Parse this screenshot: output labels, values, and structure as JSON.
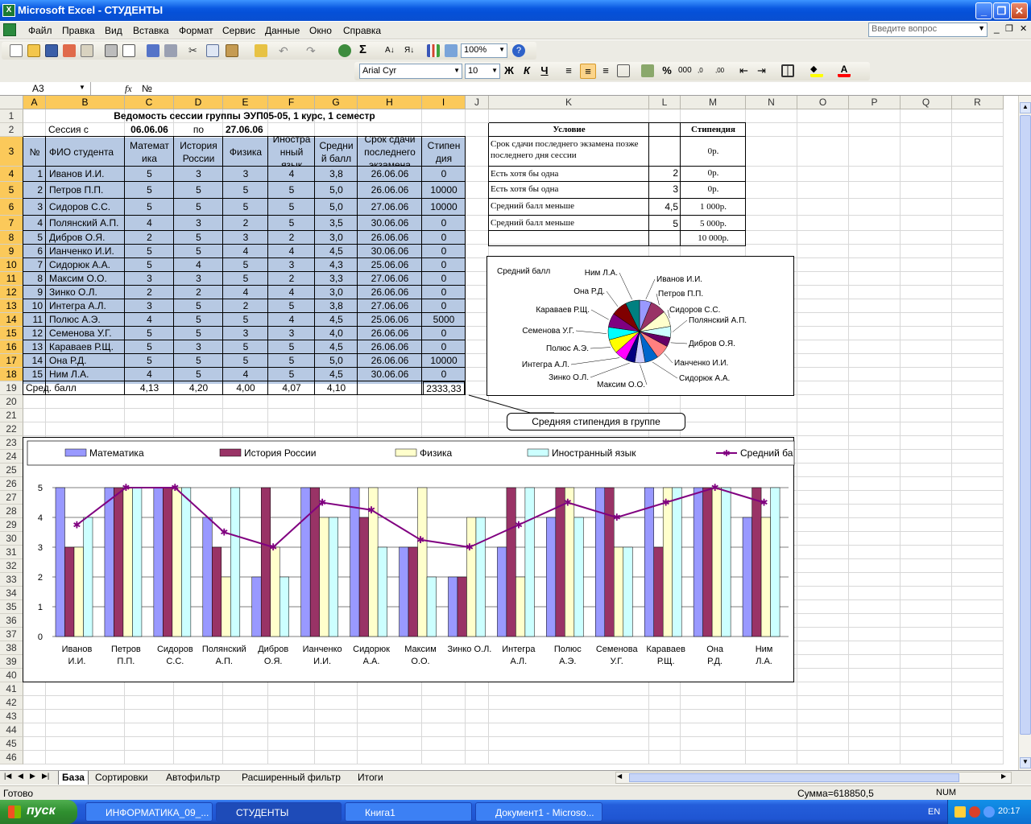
{
  "window": {
    "title": "Microsoft Excel - СТУДЕНТЫ"
  },
  "menu": [
    "Файл",
    "Правка",
    "Вид",
    "Вставка",
    "Формат",
    "Сервис",
    "Данные",
    "Окно",
    "Справка"
  ],
  "menu_extra": {
    "question_placeholder": "Введите вопрос"
  },
  "toolbar": {
    "zoom": "100%",
    "font": "Arial Cyr",
    "font_size": "10"
  },
  "formula_bar": {
    "name_box": "A3",
    "content": "№"
  },
  "columns": [
    "A",
    "B",
    "C",
    "D",
    "E",
    "F",
    "G",
    "H",
    "I",
    "J",
    "K",
    "L",
    "M",
    "N",
    "O",
    "P",
    "Q",
    "R"
  ],
  "selected_columns": [
    "A",
    "B",
    "C",
    "D",
    "E",
    "F",
    "G",
    "H",
    "I"
  ],
  "rows": [
    "1",
    "2",
    "3",
    "4",
    "5",
    "6",
    "7",
    "8",
    "9",
    "10",
    "11",
    "12",
    "13",
    "14",
    "15",
    "16",
    "17",
    "18",
    "19",
    "20",
    "21",
    "22",
    "23",
    "24",
    "25",
    "26",
    "27",
    "28",
    "29",
    "30",
    "31",
    "32",
    "33",
    "34",
    "35",
    "36",
    "37",
    "38",
    "39",
    "40",
    "41",
    "42",
    "43",
    "44",
    "45",
    "46"
  ],
  "sheet": {
    "title": "Ведомость сессии группы ЭУП05-05, 1 курс, 1 семестр",
    "session_from_label": "Сессия с",
    "session_from": "06.06.06",
    "session_to_label": "по",
    "session_to": "27.06.06",
    "headers": [
      "№",
      "ФИО студента",
      "Математ ика",
      "История России",
      "Физика",
      "Иностра нный язык",
      "Средни й балл",
      "Срок сдачи последнего экзамена",
      "Стипен дия"
    ],
    "students": [
      [
        "1",
        "Иванов И.И.",
        "5",
        "3",
        "3",
        "4",
        "3,8",
        "26.06.06",
        "0"
      ],
      [
        "2",
        "Петров П.П.",
        "5",
        "5",
        "5",
        "5",
        "5,0",
        "26.06.06",
        "10000"
      ],
      [
        "3",
        "Сидоров С.С.",
        "5",
        "5",
        "5",
        "5",
        "5,0",
        "27.06.06",
        "10000"
      ],
      [
        "4",
        "Полянский А.П.",
        "4",
        "3",
        "2",
        "5",
        "3,5",
        "30.06.06",
        "0"
      ],
      [
        "5",
        "Дибров О.Я.",
        "2",
        "5",
        "3",
        "2",
        "3,0",
        "26.06.06",
        "0"
      ],
      [
        "6",
        "Ианченко И.И.",
        "5",
        "5",
        "4",
        "4",
        "4,5",
        "30.06.06",
        "0"
      ],
      [
        "7",
        "Сидорюк А.А.",
        "5",
        "4",
        "5",
        "3",
        "4,3",
        "25.06.06",
        "0"
      ],
      [
        "8",
        "Максим О.О.",
        "3",
        "3",
        "5",
        "2",
        "3,3",
        "27.06.06",
        "0"
      ],
      [
        "9",
        "Зинко О.Л.",
        "2",
        "2",
        "4",
        "4",
        "3,0",
        "26.06.06",
        "0"
      ],
      [
        "10",
        "Интегра А.Л.",
        "3",
        "5",
        "2",
        "5",
        "3,8",
        "27.06.06",
        "0"
      ],
      [
        "11",
        "Полюс А.Э.",
        "4",
        "5",
        "5",
        "4",
        "4,5",
        "25.06.06",
        "5000"
      ],
      [
        "12",
        "Семенова У.Г.",
        "5",
        "5",
        "3",
        "3",
        "4,0",
        "26.06.06",
        "0"
      ],
      [
        "13",
        "Караваев Р.Щ.",
        "5",
        "3",
        "5",
        "5",
        "4,5",
        "26.06.06",
        "0"
      ],
      [
        "14",
        "Она Р.Д.",
        "5",
        "5",
        "5",
        "5",
        "5,0",
        "26.06.06",
        "10000"
      ],
      [
        "15",
        "Ним Л.А.",
        "4",
        "5",
        "4",
        "5",
        "4,5",
        "30.06.06",
        "0"
      ]
    ],
    "avg_label": "Сред. балл",
    "averages": [
      "4,13",
      "4,20",
      "4,00",
      "4,07",
      "4,10"
    ],
    "avg_stipend": "2333,33",
    "conditions_header": [
      "Условие",
      "Стипендия"
    ],
    "conditions": [
      {
        "text": "Срок сдачи последнего экзамена позже последнего дня сессии",
        "val": "",
        "stip": "0р."
      },
      {
        "text": "Есть хотя бы одна",
        "val": "2",
        "stip": "0р."
      },
      {
        "text": "Есть хотя бы одна",
        "val": "3",
        "stip": "0р."
      },
      {
        "text": "Средний балл меньше",
        "val": "4,5",
        "stip": "1 000р."
      },
      {
        "text": "Средний балл меньше",
        "val": "5",
        "stip": "5 000р."
      },
      {
        "text": "",
        "val": "",
        "stip": "10 000р."
      }
    ],
    "callout": "Средняя стипендия в группе"
  },
  "pie_chart": {
    "title": "Средний балл",
    "labels": [
      "Иванов И.И.",
      "Петров П.П.",
      "Сидоров С.С.",
      "Полянский А.П.",
      "Дибров О.Я.",
      "Ианченко И.И.",
      "Сидорюк А.А.",
      "Максим О.О.",
      "Зинко О.Л.",
      "Интегра А.Л.",
      "Полюс А.Э.",
      "Семенова У.Г.",
      "Караваев Р.Щ.",
      "Она Р.Д.",
      "Ним Л.А."
    ],
    "values": [
      3.75,
      5,
      5,
      3.5,
      3,
      4.5,
      4.25,
      3.25,
      3,
      3.75,
      4.5,
      4,
      4.5,
      5,
      4.5
    ],
    "colors": [
      "#9999ff",
      "#993366",
      "#ffffcc",
      "#ccffff",
      "#660066",
      "#ff8080",
      "#0066cc",
      "#ccccff",
      "#000080",
      "#ff00ff",
      "#ffff00",
      "#00ffff",
      "#800080",
      "#800000",
      "#008080"
    ]
  },
  "chart_data": {
    "type": "bar",
    "categories": [
      "Иванов И.И.",
      "Петров П.П.",
      "Сидоров С.С.",
      "Полянский А.П.",
      "Дибров О.Я.",
      "Ианченко И.И.",
      "Сидорюк А.А.",
      "Максим О.О.",
      "Зинко О.Л.",
      "Интегра А.Л.",
      "Полюс А.Э.",
      "Семенова У.Г.",
      "Караваев Р.Щ.",
      "Она Р.Д.",
      "Ним Л.А."
    ],
    "series": [
      {
        "name": "Математика",
        "color": "#9999ff",
        "values": [
          5,
          5,
          5,
          4,
          2,
          5,
          5,
          3,
          2,
          3,
          4,
          5,
          5,
          5,
          4
        ]
      },
      {
        "name": "История России",
        "color": "#993366",
        "values": [
          3,
          5,
          5,
          3,
          5,
          5,
          4,
          3,
          2,
          5,
          5,
          5,
          3,
          5,
          5
        ]
      },
      {
        "name": "Физика",
        "color": "#ffffcc",
        "values": [
          3,
          5,
          5,
          2,
          3,
          4,
          5,
          5,
          4,
          2,
          5,
          3,
          5,
          5,
          4
        ]
      },
      {
        "name": "Иностранный язык",
        "color": "#ccffff",
        "values": [
          4,
          5,
          5,
          5,
          2,
          4,
          3,
          2,
          4,
          5,
          4,
          3,
          5,
          5,
          5
        ]
      },
      {
        "name": "Средний ба",
        "type": "line",
        "color": "#800080",
        "values": [
          3.75,
          5,
          5,
          3.5,
          3,
          4.5,
          4.25,
          3.25,
          3,
          3.75,
          4.5,
          4,
          4.5,
          5,
          4.5
        ]
      }
    ],
    "ylim": [
      0,
      5
    ],
    "yticks": [
      "0",
      "1",
      "2",
      "3",
      "4",
      "5"
    ],
    "legend": "top"
  },
  "sheets": [
    "База",
    "Сортировки",
    "Автофильтр",
    "Расширенный фильтр",
    "Итоги"
  ],
  "status": {
    "ready": "Готово",
    "sum": "Сумма=618850,5",
    "num": "NUM"
  },
  "taskbar": {
    "start": "пуск",
    "items": [
      "ИНФОРМАТИКА_09_...",
      "СТУДЕНТЫ",
      "Книга1",
      "Документ1 - Microso..."
    ],
    "lang": "EN",
    "clock": "20:17"
  }
}
